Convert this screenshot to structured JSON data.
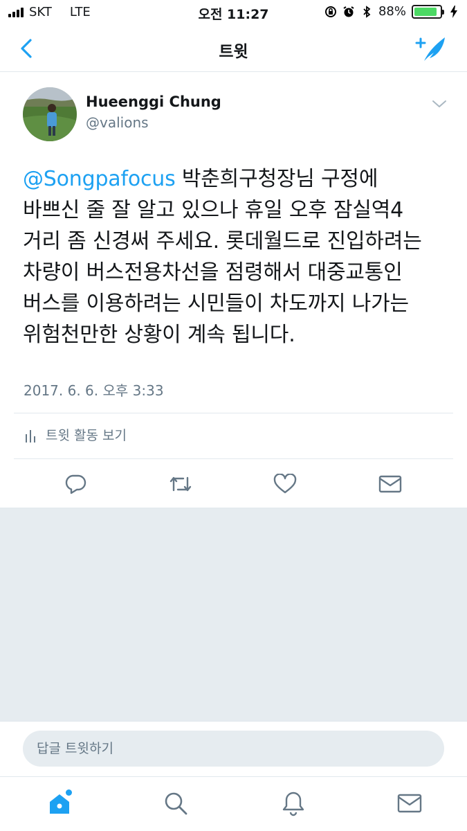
{
  "status_bar": {
    "carrier": "SKT",
    "network": "LTE",
    "time": "오전 11:27",
    "battery_percent": "88%",
    "battery_level": 0.88
  },
  "nav": {
    "title": "트윗"
  },
  "tweet": {
    "display_name": "Hueenggi Chung",
    "handle": "@valions",
    "mention": "@Songpafocus",
    "text_lines": [
      " 박춘희구청장님 구정에",
      "바쁘신 줄 잘 알고 있으나 휴일 오후 잠실역4",
      "거리 좀 신경써 주세요. 롯데월드로 진입하려는",
      "차량이 버스전용차선을 점령해서 대중교통인",
      "버스를 이용하려는 시민들이 차도까지 나가는",
      "위험천만한 상황이 계속 됩니다."
    ],
    "timestamp": "2017. 6. 6. 오후 3:33",
    "activity_label": "트윗 활동 보기"
  },
  "reply": {
    "placeholder": "답글 트윗하기"
  },
  "colors": {
    "accent": "#1da1f2",
    "secondary_text": "#657786",
    "divider": "#e1e8ed",
    "background_gray": "#e6ecf0",
    "battery": "#4cd964"
  },
  "icons": {
    "back": "chevron-left-icon",
    "compose": "compose-tweet-icon",
    "caret": "chevron-down-icon",
    "activity": "bar-chart-icon",
    "reply": "reply-icon",
    "retweet": "retweet-icon",
    "like": "heart-icon",
    "dm": "envelope-icon",
    "home": "home-icon",
    "search": "search-icon",
    "notifications": "bell-icon",
    "messages": "envelope-icon"
  }
}
